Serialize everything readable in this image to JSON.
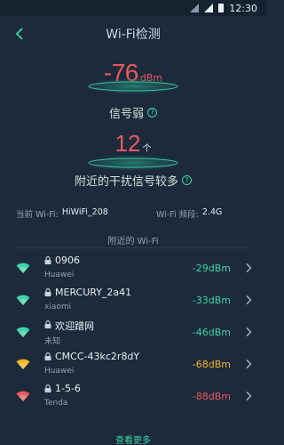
{
  "status_bar": {
    "time": "12:30"
  },
  "header": {
    "title": "Wi-Fi检测"
  },
  "signal": {
    "value": "-76",
    "unit": "dBm",
    "label": "信号弱",
    "help": "?"
  },
  "interference": {
    "value": "12",
    "unit": "个",
    "label": "附近的干扰信号较多",
    "help": "?"
  },
  "current": {
    "ssid_label": "当前 Wi-Fi:",
    "ssid": "HiWiFi_208",
    "band_label": "Wi-Fi 频段:",
    "band": "2.4G"
  },
  "nearby_title": "附近的 Wi-Fi",
  "networks": [
    {
      "ssid": "0906",
      "vendor": "Huawei",
      "rssi": "-29dBm",
      "color": "#3fd3a6"
    },
    {
      "ssid": "MERCURY_2a41",
      "vendor": "xiaomi",
      "rssi": "-33dBm",
      "color": "#3fd3a6"
    },
    {
      "ssid": "欢迎蹭网",
      "vendor": "未知",
      "rssi": "-46dBm",
      "color": "#3fd3a6"
    },
    {
      "ssid": "CMCC-43kc2r8dY",
      "vendor": "Huawei",
      "rssi": "-68dBm",
      "color": "#f2b424"
    },
    {
      "ssid": "1-5-6",
      "vendor": "Tenda",
      "rssi": "-88dBm",
      "color": "#e8595d"
    }
  ],
  "more_label": "查看更多",
  "colors": {
    "background": "#1c2a3b",
    "accent": "#3fd3a6",
    "warning": "#f2b424",
    "danger": "#e8595d"
  }
}
